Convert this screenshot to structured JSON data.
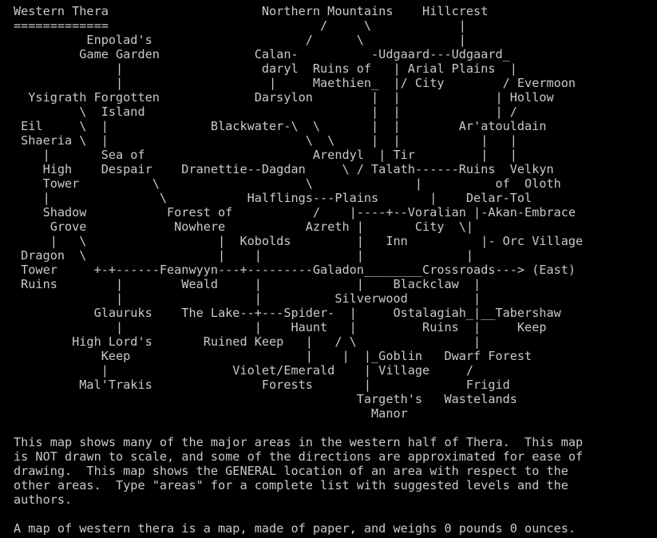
{
  "terminal": {
    "background_color": "#000000",
    "text_color": "#c9c9c9",
    "font_char_width_px": 10,
    "font_line_height_px": 18
  },
  "map": {
    "title": "Western Thera",
    "title_underline": "=============",
    "ascii_art": "Western Thera\n=============\n          Enpolad's                                           \n          Game Garden                                         \n             |                                                \n             |                                                \n Ysigrath Forgotten                                           \n       \\  Island                                              \n Eil   \\  |                                                   \nShaeria \\ |                                                   \n  |     Sea of                                                \n High   Despair                                               \n Tower        \\                                               \n  |            \\                                              \n Shadow                                                       \n Grove                                                        \n  |   \\                                                       \nDragon  \\                                                     \nTower                                                         \nRuins                                                         ",
    "regions": [
      "Western Thera",
      "Enpolad's Game Garden",
      "Ysigrath",
      "Forgotten Island",
      "Eil",
      "Shaeria",
      "Sea of Despair",
      "High Tower",
      "Shadow Grove",
      "Dragon Tower Ruins",
      "Northern Mountains",
      "Hillcrest",
      "Calandaryl",
      "Darsylon",
      "Blackwater",
      "Udgaard",
      "Udgaard Plains",
      "Ruins of Maethien",
      "Arial City",
      "Evermoon Hollow",
      "Ar'atouldain",
      "Arendyl",
      "Tir Talath",
      "Ruins of Delar-Tol",
      "Velkyn Oloth",
      "Dranettie",
      "Dagdan",
      "Halflings Plains",
      "Azreth",
      "Voralian City",
      "Akan-Embrace",
      "Kobolds",
      "Inn",
      "Orc Village",
      "Feanwyyn Weald",
      "Galadon",
      "Crossroads",
      "Blackclaw",
      "Glauruks",
      "The Lake",
      "Spider-Haunt",
      "Silverwood",
      "Ostalagiah Ruins",
      "Tabershaw Keep",
      "High Lord's Keep",
      "Ruined Keep",
      "Mal'Trakis",
      "Violet/Emerald Forests",
      "Goblin Village",
      "Dwarf Forest",
      "Targeth's Manor",
      "Frigid Wastelands",
      "(East)"
    ],
    "lines": [
      "Western Thera                     Northern Mountains   Hillcrest",
      "=============                        /     \\              |",
      "          Enpolad's                 /       \\             |",
      "          Game Garden        Calan-        -Udgaard---Udgaard_",
      "             |               daryl   Ruins of | Arial  Plains |",
      "             |                 |     Maethien_ |/ City      / Evermoon",
      " Ysigrath Forgotten          Darsylon         | |            | Hollow",
      "       \\  Island                     \\        | |            | /",
      " Eil   \\  |         Blackwater-\\  \\      | |           Ar'atouldain",
      "Shaeria \\ |                    \\  \\      | |             |   |",
      "  |     Sea of                  Arendyl | Tir            |   |",
      " High   Despair   Dranettie--Dagdan  \\ / Talath------Ruins  Velkyn",
      " Tower        \\                   \\      |           of    Oloth",
      "  |            \\      Halflings---Plains      |      Delar-Tol",
      " Shadow        Forest of      /     |----+--Voralian |-Akan-Embrace",
      " Grove          Nowhere     Azreth  |    |   City   \\|",
      "  |   \\                |  Kobolds   |    |  Inn      |- Orc Village",
      "Dragon  \\              |    |       |            |",
      "Tower   +-+------Feanwyyn---+---------Galadon________Crossroads---> (East)",
      "Ruins     |      Weald      |         |      Blackclaw  |",
      "          |                 |       Silverwood          |",
      "      Glauruks   The Lake--+---Spider-  |    Ostalagiah_|__Tabershaw",
      "          |                |    Haunt   |       Ruins   |     Keep",
      "     High Lord's   Ruined Keep  |   / \\              |",
      "        Keep                    |  |  |_Goblin     Dwarf Forest",
      "         |           Violet/Emerald | Village       /",
      "     Mal'Trakis        Forests      |             Frigid",
      "                                Targeth's        Wastelands",
      "                                 Manor"
    ]
  },
  "description": {
    "paragraph": "This map shows many of the major areas in the western half of Thera.  This map\nis NOT drawn to scale, and some of the directions are approximated for ease of\ndrawing.  This map shows the GENERAL location of an area with respect to the\nother areas.  Type \"areas\" for a complete list with suggested levels and the\nauthors.",
    "item_line": "A map of western thera is a map, made of paper, and weighs 0 pounds 0 ounces."
  },
  "map_art_rows": [
    "Western Thera                    Northern Mountains   Hillcrest",
    "=============                        /     \\              |",
    "          Enpolad's                 /       \\             |",
    "          Game Garden        Calan-        -Udgaard---Udgaard_",
    "             |               daryl   Ruins of | Arial  Plains |",
    "             |                 |     Maethien_ |/ City      / Evermoon",
    " Ysigrath Forgotten          Darsylon         | |           | Hollow",
    "       \\  Island                     \\        | |           | /",
    " Eil   \\  |         Blackwater-\\  \\           | |        Ar'atouldain",
    "Shaeria \\ |                   \\  \\            | |          |   |",
    "  |     Sea of                 Arendyl | Tir             |   |",
    " High   Despair   Dranettie--Dagdan  \\ / Talath------Ruins  Velkyn",
    " Tower        \\                   \\        |          of    Oloth",
    "  |            \\      Halflings---Plains      |     Delar-Tol",
    " Shadow        Forest of      /    |----+--Voralian |-Akan-Embrace",
    " Grove          Nowhere     Azreth |    |   City   \\|",
    "  |   \\                |  Kobolds  |    |  Inn      |- Orc Village",
    "Dragon  \\              |    |      |          |",
    "Tower   +-+------Feanwyyn---+---------Galadon________Crossroads---> (East)",
    "Ruins     |      Weald      |        |     Blackclaw   |",
    "          |                 |      Silverwood          |",
    "      Glauruks   The Lake--+---Spider- |   Ostalagiah_|__Tabershaw",
    "          |                |   Haunt  |      Ruins   |     Keep",
    "     High Lord's   Ruined Keep |   / \\             |",
    "        Keep                   |  |  |_Goblin    Dwarf Forest",
    "         |          Violet/Emerald | Village      /",
    "     Mal'Trakis       Forests      |            Frigid",
    "                               Targeth's       Wastelands",
    "                                Manor"
  ]
}
